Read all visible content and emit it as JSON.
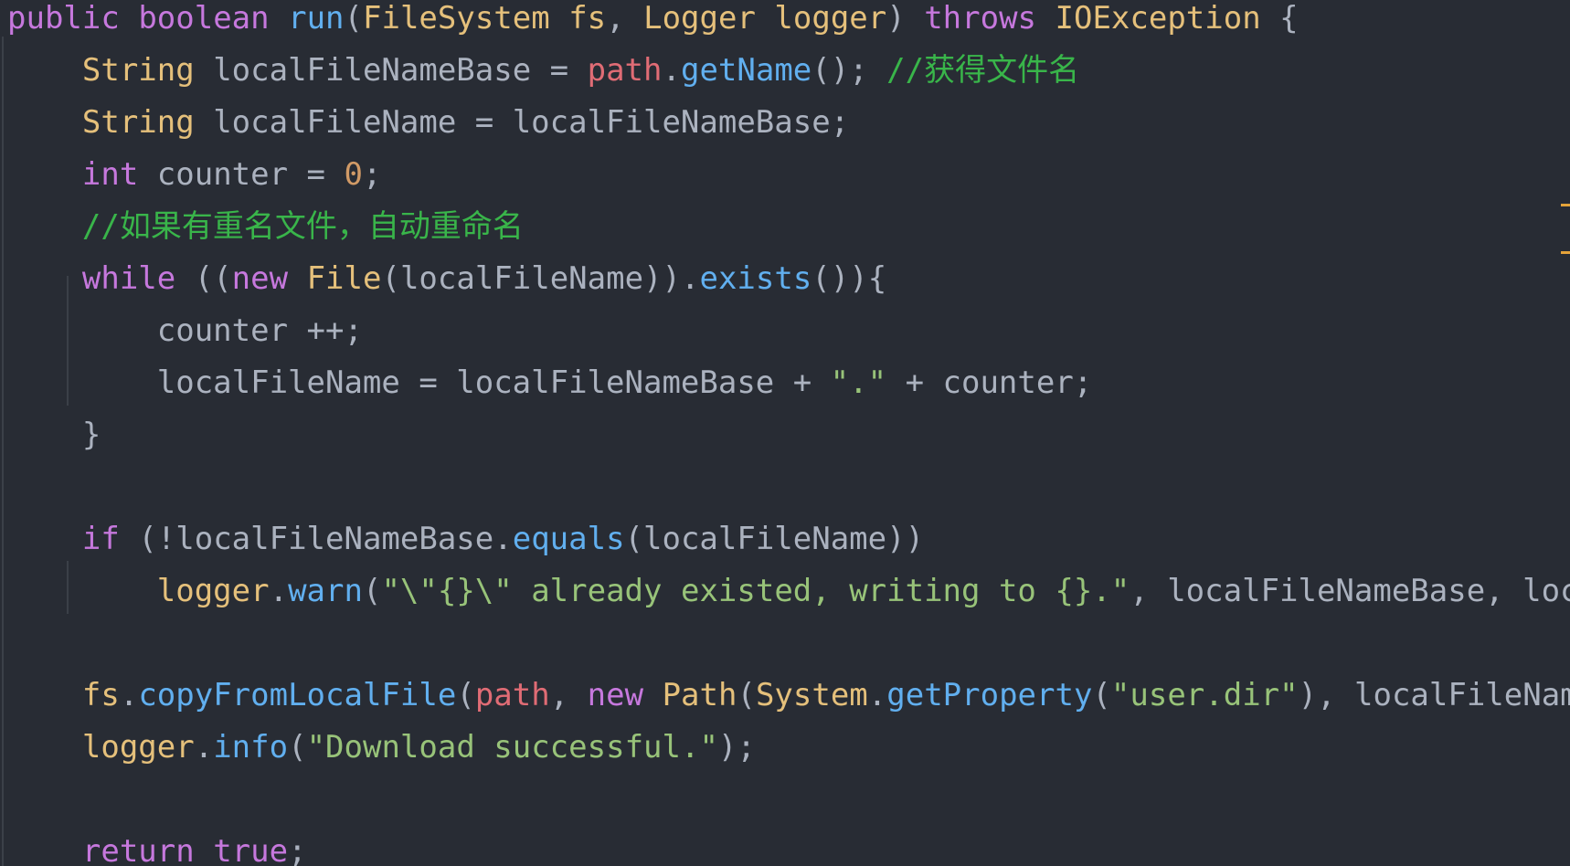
{
  "editor": {
    "lines": [
      [
        {
          "t": "public",
          "c": "kw"
        },
        {
          "t": " ",
          "c": "pl"
        },
        {
          "t": "boolean",
          "c": "kw"
        },
        {
          "t": " ",
          "c": "pl"
        },
        {
          "t": "run",
          "c": "fn"
        },
        {
          "t": "(",
          "c": "pl"
        },
        {
          "t": "FileSystem",
          "c": "ty"
        },
        {
          "t": " ",
          "c": "pl"
        },
        {
          "t": "fs",
          "c": "pa"
        },
        {
          "t": ", ",
          "c": "pl"
        },
        {
          "t": "Logger",
          "c": "ty"
        },
        {
          "t": " ",
          "c": "pl"
        },
        {
          "t": "logger",
          "c": "pa"
        },
        {
          "t": ") ",
          "c": "pl"
        },
        {
          "t": "throws",
          "c": "kw"
        },
        {
          "t": " ",
          "c": "pl"
        },
        {
          "t": "IOException",
          "c": "ty"
        },
        {
          "t": " {",
          "c": "pl"
        }
      ],
      [
        {
          "t": "    ",
          "c": "pl"
        },
        {
          "t": "String",
          "c": "ty"
        },
        {
          "t": " localFileNameBase = ",
          "c": "pl"
        },
        {
          "t": "path",
          "c": "fld"
        },
        {
          "t": ".",
          "c": "pl"
        },
        {
          "t": "getName",
          "c": "fn"
        },
        {
          "t": "(); ",
          "c": "pl"
        },
        {
          "t": "//获得文件名",
          "c": "cmt"
        }
      ],
      [
        {
          "t": "    ",
          "c": "pl"
        },
        {
          "t": "String",
          "c": "ty"
        },
        {
          "t": " localFileName = localFileNameBase;",
          "c": "pl"
        }
      ],
      [
        {
          "t": "    ",
          "c": "pl"
        },
        {
          "t": "int",
          "c": "kw"
        },
        {
          "t": " counter = ",
          "c": "pl"
        },
        {
          "t": "0",
          "c": "num"
        },
        {
          "t": ";",
          "c": "pl"
        }
      ],
      [
        {
          "t": "    ",
          "c": "pl"
        },
        {
          "t": "//如果有重名文件，自动重命名",
          "c": "cmt"
        }
      ],
      [
        {
          "t": "    ",
          "c": "pl"
        },
        {
          "t": "while",
          "c": "kw"
        },
        {
          "t": " ((",
          "c": "pl"
        },
        {
          "t": "new",
          "c": "kw"
        },
        {
          "t": " ",
          "c": "pl"
        },
        {
          "t": "File",
          "c": "ty"
        },
        {
          "t": "(localFileName)).",
          "c": "pl"
        },
        {
          "t": "exists",
          "c": "fn"
        },
        {
          "t": "()){",
          "c": "pl"
        }
      ],
      [
        {
          "t": "        counter ++;",
          "c": "pl"
        }
      ],
      [
        {
          "t": "        localFileName = localFileNameBase + ",
          "c": "pl"
        },
        {
          "t": "\".\"",
          "c": "str"
        },
        {
          "t": " + counter;",
          "c": "pl"
        }
      ],
      [
        {
          "t": "    }",
          "c": "pl"
        }
      ],
      [],
      [
        {
          "t": "    ",
          "c": "pl"
        },
        {
          "t": "if",
          "c": "kw"
        },
        {
          "t": " (!localFileNameBase.",
          "c": "pl"
        },
        {
          "t": "equals",
          "c": "fn"
        },
        {
          "t": "(localFileName))",
          "c": "pl"
        }
      ],
      [
        {
          "t": "        ",
          "c": "pl"
        },
        {
          "t": "logger",
          "c": "ob"
        },
        {
          "t": ".",
          "c": "pl"
        },
        {
          "t": "warn",
          "c": "fn"
        },
        {
          "t": "(",
          "c": "pl"
        },
        {
          "t": "\"\\\"{}\\\" already existed, writing to {}.\"",
          "c": "str"
        },
        {
          "t": ", localFileNameBase, local",
          "c": "pl"
        }
      ],
      [],
      [
        {
          "t": "    ",
          "c": "pl"
        },
        {
          "t": "fs",
          "c": "ob"
        },
        {
          "t": ".",
          "c": "pl"
        },
        {
          "t": "copyFromLocalFile",
          "c": "fn"
        },
        {
          "t": "(",
          "c": "pl"
        },
        {
          "t": "path",
          "c": "fld"
        },
        {
          "t": ", ",
          "c": "pl"
        },
        {
          "t": "new",
          "c": "kw"
        },
        {
          "t": " ",
          "c": "pl"
        },
        {
          "t": "Path",
          "c": "ty"
        },
        {
          "t": "(",
          "c": "pl"
        },
        {
          "t": "System",
          "c": "ty"
        },
        {
          "t": ".",
          "c": "pl"
        },
        {
          "t": "getProperty",
          "c": "fn"
        },
        {
          "t": "(",
          "c": "pl"
        },
        {
          "t": "\"user.dir\"",
          "c": "str"
        },
        {
          "t": "), localFileName)",
          "c": "pl"
        }
      ],
      [
        {
          "t": "    ",
          "c": "pl"
        },
        {
          "t": "logger",
          "c": "ob"
        },
        {
          "t": ".",
          "c": "pl"
        },
        {
          "t": "info",
          "c": "fn"
        },
        {
          "t": "(",
          "c": "pl"
        },
        {
          "t": "\"Download successful.\"",
          "c": "str"
        },
        {
          "t": ");",
          "c": "pl"
        }
      ],
      [],
      [
        {
          "t": "    ",
          "c": "pl"
        },
        {
          "t": "return",
          "c": "kw"
        },
        {
          "t": " ",
          "c": "pl"
        },
        {
          "t": "true",
          "c": "kw"
        },
        {
          "t": ";",
          "c": "pl"
        }
      ]
    ]
  },
  "colors": {
    "background": "#282c34",
    "keyword": "#c678dd",
    "function": "#61afef",
    "type": "#e5c07b",
    "field": "#e06c75",
    "number": "#d19a66",
    "string": "#98c379",
    "comment": "#39b54a",
    "plain": "#abb2bf",
    "gutter_marker": "#e5a33a"
  }
}
